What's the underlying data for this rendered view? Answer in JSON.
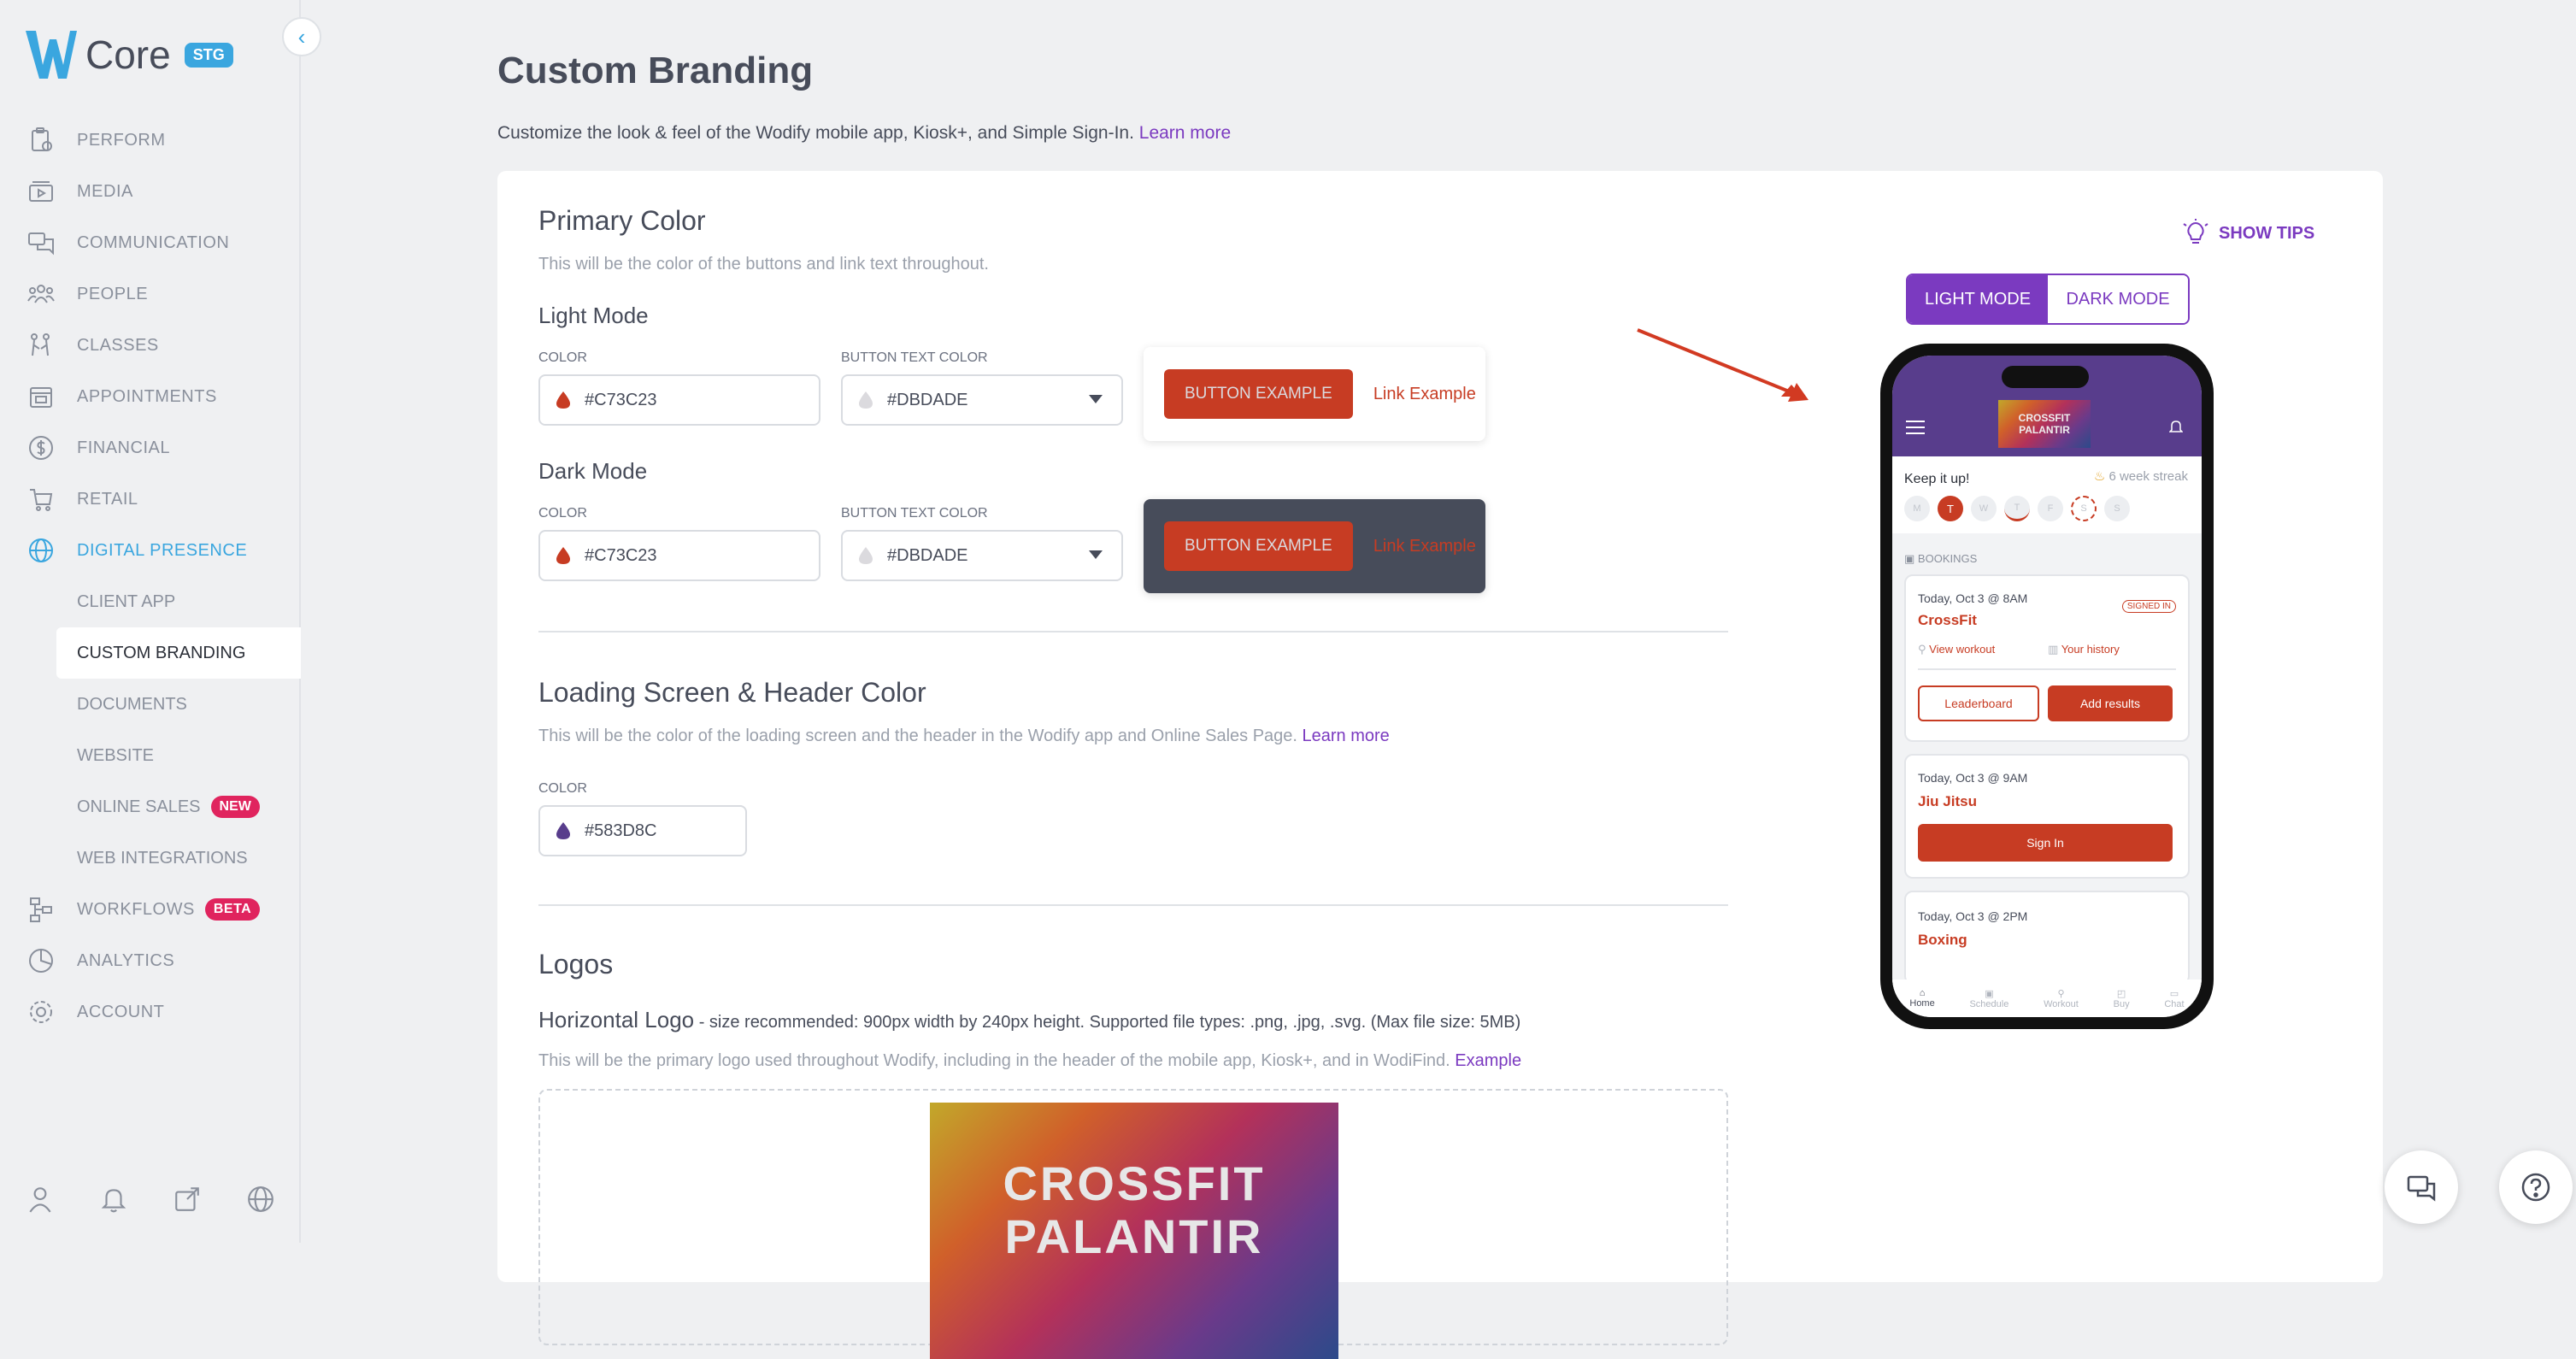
{
  "brand": {
    "name": "Core",
    "env_badge": "STG"
  },
  "sidebar": {
    "items": [
      {
        "label": "PERFORM"
      },
      {
        "label": "MEDIA"
      },
      {
        "label": "COMMUNICATION"
      },
      {
        "label": "PEOPLE"
      },
      {
        "label": "CLASSES"
      },
      {
        "label": "APPOINTMENTS"
      },
      {
        "label": "FINANCIAL"
      },
      {
        "label": "RETAIL"
      },
      {
        "label": "DIGITAL PRESENCE"
      },
      {
        "label": "WORKFLOWS",
        "badge": "BETA"
      },
      {
        "label": "ANALYTICS"
      },
      {
        "label": "ACCOUNT"
      }
    ],
    "subitems": [
      {
        "label": "CLIENT APP"
      },
      {
        "label": "CUSTOM BRANDING"
      },
      {
        "label": "DOCUMENTS"
      },
      {
        "label": "WEBSITE"
      },
      {
        "label": "ONLINE SALES",
        "badge": "NEW"
      },
      {
        "label": "WEB INTEGRATIONS"
      }
    ]
  },
  "page": {
    "title": "Custom Branding",
    "description": "Customize the look & feel of the Wodify mobile app, Kiosk+, and Simple Sign-In.",
    "learn_more": "Learn more"
  },
  "primary": {
    "title": "Primary Color",
    "description": "This will be the color of the buttons and link text throughout.",
    "light": {
      "heading": "Light Mode",
      "color_label": "COLOR",
      "color_value": "#C73C23",
      "btn_text_label": "BUTTON TEXT COLOR",
      "btn_text_value": "#DBDADE"
    },
    "dark": {
      "heading": "Dark Mode",
      "color_label": "COLOR",
      "color_value": "#C73C23",
      "btn_text_label": "BUTTON TEXT COLOR",
      "btn_text_value": "#DBDADE"
    },
    "button_example": "BUTTON EXAMPLE",
    "link_example": "Link Example"
  },
  "loading": {
    "title": "Loading Screen & Header Color",
    "description": "This will be the color of the loading screen and the header in the Wodify app and Online Sales Page.",
    "learn_more": "Learn more",
    "color_label": "COLOR",
    "color_value": "#583D8C"
  },
  "logos": {
    "title": "Logos",
    "horizontal_title": "Horizontal Logo",
    "horizontal_hint": "- size recommended: 900px width by 240px height. Supported file types: .png, .jpg, .svg. (Max file size: 5MB)",
    "horizontal_desc": "This will be the primary logo used throughout Wodify, including in the header of the mobile app, Kiosk+, and in WodiFind.",
    "example": "Example",
    "logo_line1": "CROSSFIT",
    "logo_line2": "PALANTIR"
  },
  "preview": {
    "show_tips": "SHOW TIPS",
    "light_mode": "LIGHT MODE",
    "dark_mode": "DARK MODE",
    "phone": {
      "logo_text": "CROSSFIT PALANTIR",
      "keep_it_up": "Keep it up!",
      "streak": "6 week streak",
      "days": [
        "M",
        "T",
        "W",
        "T",
        "F",
        "S",
        "S"
      ],
      "bookings_label": "BOOKINGS",
      "c1_time": "Today, Oct 3 @ 8AM",
      "c1_class": "CrossFit",
      "c1_badge": "SIGNED IN",
      "c1_view": "View workout",
      "c1_hist": "Your history",
      "c1_leader": "Leaderboard",
      "c1_add": "Add results",
      "c2_time": "Today, Oct 3 @ 9AM",
      "c2_class": "Jiu Jitsu",
      "c2_signin": "Sign In",
      "c3_time": "Today, Oct 3 @ 2PM",
      "c3_class": "Boxing",
      "tabs": [
        "Home",
        "Schedule",
        "Workout",
        "Buy",
        "Chat"
      ]
    }
  },
  "colors": {
    "primary": "#C73C23",
    "button_text": "#DBDADE",
    "header": "#583D8C",
    "accent": "#7B3AC0",
    "nav_active": "#3AA6DF"
  }
}
